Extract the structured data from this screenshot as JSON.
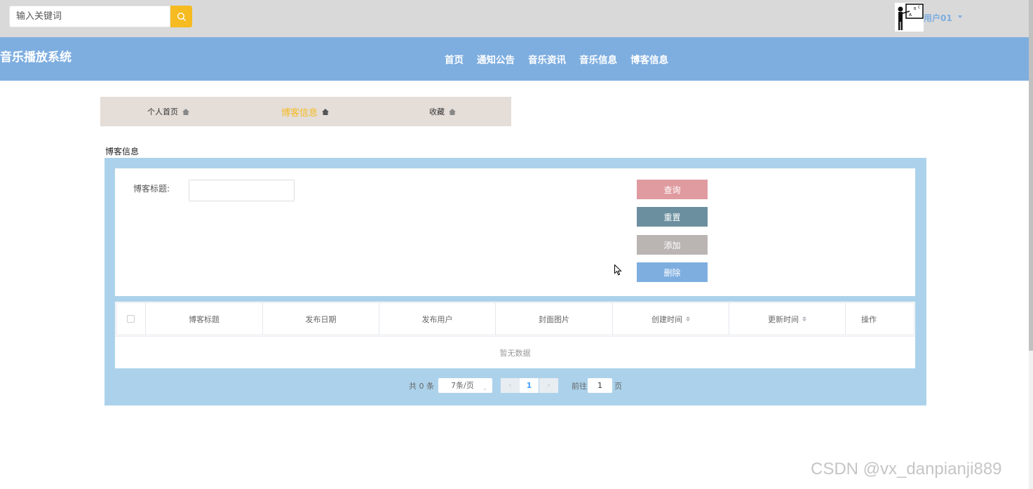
{
  "search": {
    "placeholder": "输入关键词"
  },
  "user": {
    "name": "用户01"
  },
  "nav": {
    "site_title": "音乐播放系统",
    "links": [
      "首页",
      "通知公告",
      "音乐资讯",
      "音乐信息",
      "博客信息"
    ]
  },
  "tabs": [
    {
      "label": "个人首页",
      "icon": "home-icon"
    },
    {
      "label": "博客信息",
      "icon": "home-icon",
      "active": true
    },
    {
      "label": "收藏",
      "icon": "home-icon"
    }
  ],
  "section_title": "博客信息",
  "filter": {
    "label": "博客标题:",
    "value": ""
  },
  "buttons": {
    "query": "查询",
    "reset": "重置",
    "add": "添加",
    "delete": "删除"
  },
  "table": {
    "columns": [
      "博客标题",
      "发布日期",
      "发布用户",
      "封面图片",
      "创建时间",
      "更新时间",
      "操作"
    ],
    "empty_text": "暂无数据"
  },
  "pager": {
    "total_label": "共 0 条",
    "page_size": "7条/页",
    "current_page": "1",
    "goto_label": "前往",
    "goto_value": "1",
    "page_suffix": "页"
  },
  "colors": {
    "accent": "#f5bb21",
    "navbar": "#7eaee0",
    "panel": "#acd2eb",
    "query": "#df9ba0",
    "reset": "#6b8f9f",
    "add": "#bab5b3",
    "delete": "#7eaee0"
  },
  "watermark": "CSDN @vx_danpianji889"
}
